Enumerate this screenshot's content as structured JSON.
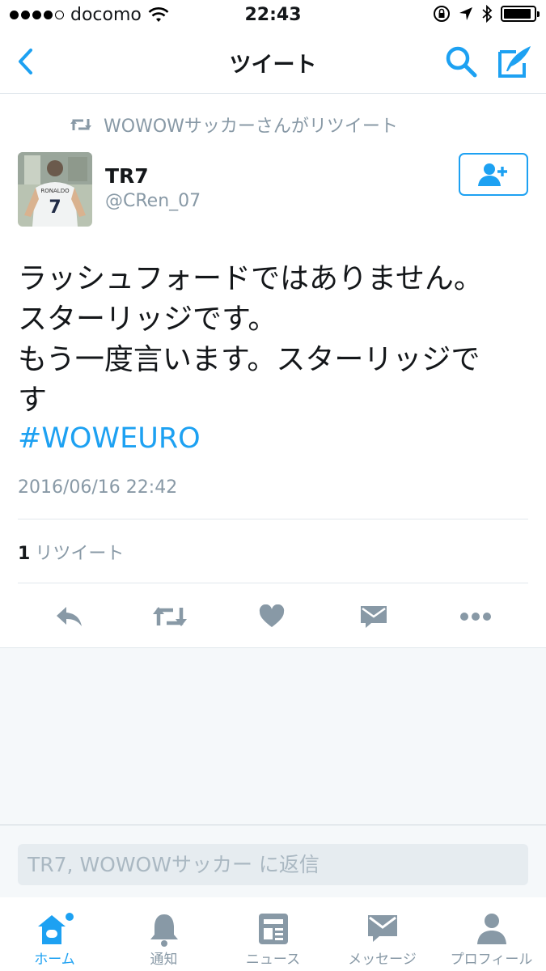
{
  "status_bar": {
    "carrier": "docomo",
    "time": "22:43",
    "signal_bars": 4
  },
  "nav": {
    "title": "ツイート",
    "icons": [
      "chevron-left-icon",
      "search-icon",
      "compose-icon"
    ]
  },
  "retweet_context": {
    "text": "WOWOWサッカーさんがリツイート"
  },
  "tweet": {
    "author_name": "TR7",
    "author_handle": "@CRen_07",
    "lines": [
      "ラッシュフォードではありません。",
      "スターリッジです。",
      "もう一度言います。スターリッジで",
      "す"
    ],
    "hashtag": "#WOWEURO",
    "timestamp": "2016/06/16 22:42",
    "retweet_count": "1",
    "retweet_label": "リツイート"
  },
  "actions": [
    "reply-icon",
    "retweet-icon",
    "like-icon",
    "message-icon",
    "more-icon"
  ],
  "reply": {
    "placeholder": "TR7, WOWOWサッカー に返信"
  },
  "tabs": [
    {
      "label": "ホーム",
      "icon": "home-icon",
      "active": true
    },
    {
      "label": "通知",
      "icon": "bell-icon",
      "active": false
    },
    {
      "label": "ニュース",
      "icon": "news-icon",
      "active": false
    },
    {
      "label": "メッセージ",
      "icon": "envelope-icon",
      "active": false
    },
    {
      "label": "プロフィール",
      "icon": "person-icon",
      "active": false
    }
  ],
  "colors": {
    "accent": "#1da1f2",
    "muted": "#8899a6",
    "background_gray": "#f5f8fa"
  }
}
